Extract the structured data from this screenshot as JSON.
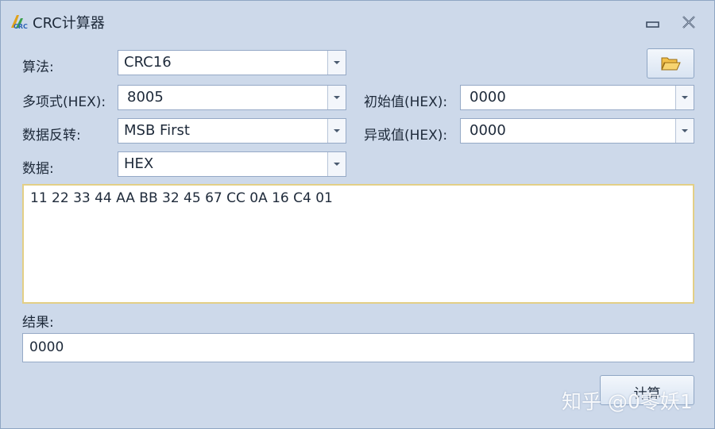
{
  "window": {
    "title": "CRC计算器",
    "icon_label": "CRC"
  },
  "form": {
    "algorithm": {
      "label": "算法:",
      "value": "CRC16"
    },
    "polynomial": {
      "label": "多项式(HEX):",
      "value": "8005"
    },
    "init_value": {
      "label": "初始值(HEX):",
      "value": "0000"
    },
    "reflect": {
      "label": "数据反转:",
      "value": "MSB First"
    },
    "xor_value": {
      "label": "异或值(HEX):",
      "value": "0000"
    },
    "data_format": {
      "label": "数据:",
      "value": "HEX"
    }
  },
  "data_input": {
    "value": "11 22 33 44 AA BB 32 45 67 CC 0A 16 C4 01"
  },
  "result": {
    "label": "结果:",
    "value": "0000"
  },
  "calculate_button": {
    "label": "计算"
  },
  "watermark": {
    "text": "知乎 @0零妖1"
  },
  "icons": {
    "minimize": "minimize-icon",
    "close": "close-icon",
    "open": "folder-open-icon",
    "dropdown": "chevron-down-icon"
  }
}
